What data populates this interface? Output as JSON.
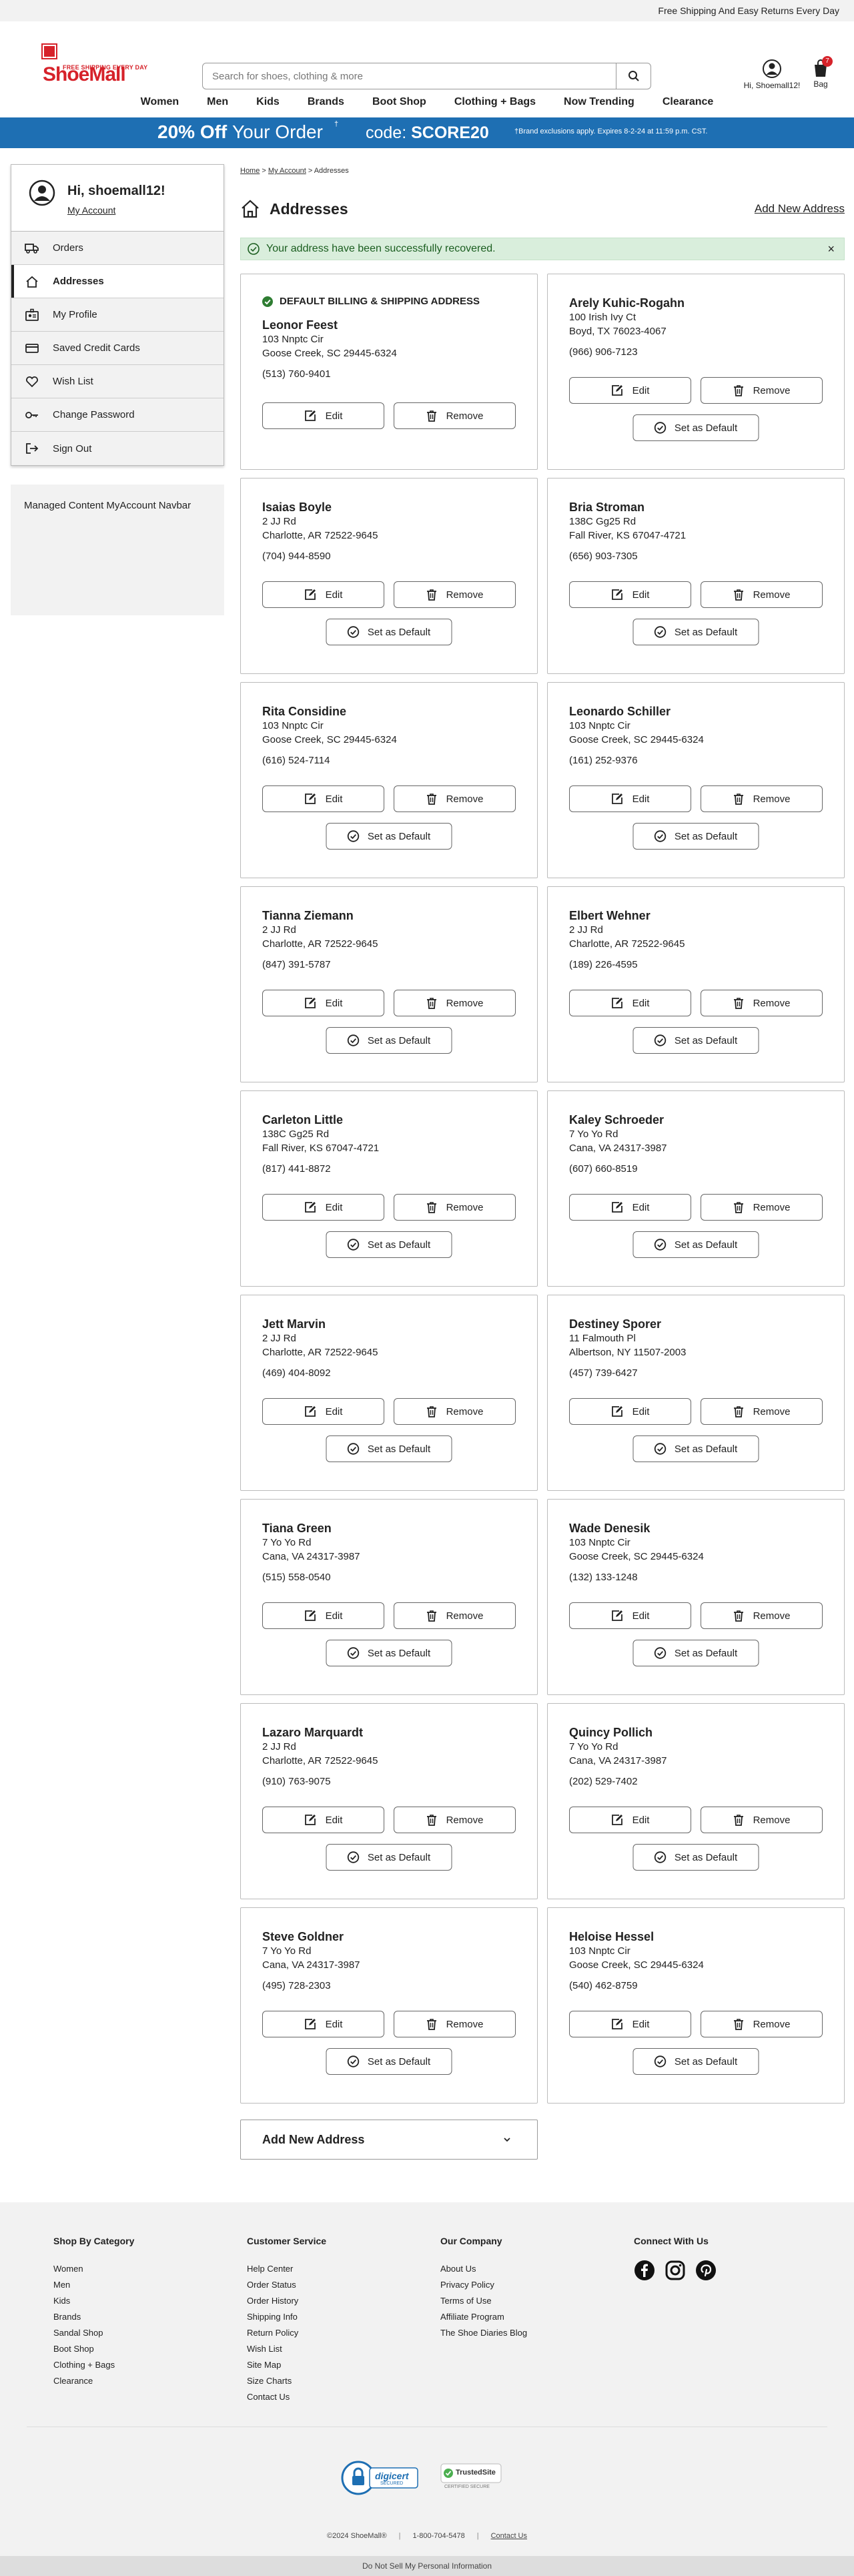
{
  "topbar": {
    "text": "Free Shipping And Easy Returns Every Day"
  },
  "header": {
    "logo_text": "ShoeMall",
    "logo_tagline": "FREE SHIPPING EVERY DAY",
    "search_placeholder": "Search for shoes, clothing & more",
    "account_label": "Hi, Shoemall12!",
    "bag_label": "Bag",
    "bag_count": "7"
  },
  "nav": [
    "Women",
    "Men",
    "Kids",
    "Brands",
    "Boot Shop",
    "Clothing + Bags",
    "Now Trending",
    "Clearance"
  ],
  "promo": {
    "amount": "20% Off",
    "rest": "Your Order",
    "sup": "†",
    "code_label": "code:",
    "code": "SCORE20",
    "fine": "†Brand exclusions apply. Expires 8-2-24 at 11:59 p.m. CST."
  },
  "sidebar": {
    "greeting": "Hi, shoemall12!",
    "account_link": "My Account",
    "items": [
      {
        "label": "Orders",
        "icon": "truck-icon"
      },
      {
        "label": "Addresses",
        "icon": "home-icon"
      },
      {
        "label": "My Profile",
        "icon": "profile-icon"
      },
      {
        "label": "Saved Credit Cards",
        "icon": "credit-card-icon"
      },
      {
        "label": "Wish List",
        "icon": "heart-icon"
      },
      {
        "label": "Change Password",
        "icon": "key-icon"
      },
      {
        "label": "Sign Out",
        "icon": "sign-out-icon"
      }
    ],
    "managed": "Managed Content MyAccount Navbar"
  },
  "breadcrumb": {
    "home": "Home",
    "sep": ">",
    "account": "My Account",
    "current": "Addresses"
  },
  "page": {
    "title": "Addresses",
    "add_new": "Add New Address",
    "alert": "Your address have been successfully recovered.",
    "alert_close": "×",
    "default_heading": "DEFAULT BILLING & SHIPPING ADDRESS",
    "edit": "Edit",
    "remove": "Remove",
    "set_default": "Set as Default",
    "add_new_accordion": "Add New Address"
  },
  "addresses": [
    {
      "name": "Leonor Feest",
      "line1": "103 Nnptc Cir",
      "line2": "Goose Creek, SC 29445-6324",
      "phone": "(513) 760-9401",
      "default": true
    },
    {
      "name": "Arely Kuhic-Rogahn",
      "line1": "100 Irish Ivy Ct",
      "line2": "Boyd, TX 76023-4067",
      "phone": "(966) 906-7123",
      "default": false
    },
    {
      "name": "Isaias Boyle",
      "line1": "2 JJ Rd",
      "line2": "Charlotte, AR 72522-9645",
      "phone": "(704) 944-8590",
      "default": false
    },
    {
      "name": "Bria Stroman",
      "line1": "138C Gg25 Rd",
      "line2": "Fall River, KS 67047-4721",
      "phone": "(656) 903-7305",
      "default": false
    },
    {
      "name": "Rita Considine",
      "line1": "103 Nnptc Cir",
      "line2": "Goose Creek, SC 29445-6324",
      "phone": "(616) 524-7114",
      "default": false
    },
    {
      "name": "Leonardo Schiller",
      "line1": "103 Nnptc Cir",
      "line2": "Goose Creek, SC 29445-6324",
      "phone": "(161) 252-9376",
      "default": false
    },
    {
      "name": "Tianna Ziemann",
      "line1": "2 JJ Rd",
      "line2": "Charlotte, AR 72522-9645",
      "phone": "(847) 391-5787",
      "default": false
    },
    {
      "name": "Elbert Wehner",
      "line1": "2 JJ Rd",
      "line2": "Charlotte, AR 72522-9645",
      "phone": "(189) 226-4595",
      "default": false
    },
    {
      "name": "Carleton Little",
      "line1": "138C Gg25 Rd",
      "line2": "Fall River, KS 67047-4721",
      "phone": "(817) 441-8872",
      "default": false
    },
    {
      "name": "Kaley Schroeder",
      "line1": "7 Yo Yo Rd",
      "line2": "Cana, VA 24317-3987",
      "phone": "(607) 660-8519",
      "default": false
    },
    {
      "name": "Jett Marvin",
      "line1": "2 JJ Rd",
      "line2": "Charlotte, AR 72522-9645",
      "phone": "(469) 404-8092",
      "default": false
    },
    {
      "name": "Destiney Sporer",
      "line1": "11 Falmouth Pl",
      "line2": "Albertson, NY 11507-2003",
      "phone": "(457) 739-6427",
      "default": false
    },
    {
      "name": "Tiana Green",
      "line1": "7 Yo Yo Rd",
      "line2": "Cana, VA 24317-3987",
      "phone": "(515) 558-0540",
      "default": false
    },
    {
      "name": "Wade Denesik",
      "line1": "103 Nnptc Cir",
      "line2": "Goose Creek, SC 29445-6324",
      "phone": "(132) 133-1248",
      "default": false
    },
    {
      "name": "Lazaro Marquardt",
      "line1": "2 JJ Rd",
      "line2": "Charlotte, AR 72522-9645",
      "phone": "(910) 763-9075",
      "default": false
    },
    {
      "name": "Quincy Pollich",
      "line1": "7 Yo Yo Rd",
      "line2": "Cana, VA 24317-3987",
      "phone": "(202) 529-7402",
      "default": false
    },
    {
      "name": "Steve Goldner",
      "line1": "7 Yo Yo Rd",
      "line2": "Cana, VA 24317-3987",
      "phone": "(495) 728-2303",
      "default": false
    },
    {
      "name": "Heloise Hessel",
      "line1": "103 Nnptc Cir",
      "line2": "Goose Creek, SC 29445-6324",
      "phone": "(540) 462-8759",
      "default": false
    }
  ],
  "footer": {
    "columns": [
      {
        "heading": "Shop By Category",
        "links": [
          "Women",
          "Men",
          "Kids",
          "Brands",
          "Sandal Shop",
          "Boot Shop",
          "Clothing + Bags",
          "Clearance"
        ]
      },
      {
        "heading": "Customer Service",
        "links": [
          "Help Center",
          "Order Status",
          "Order History",
          "Shipping Info",
          "Return Policy",
          "Wish List",
          "Site Map",
          "Size Charts",
          "Contact Us"
        ]
      },
      {
        "heading": "Our Company",
        "links": [
          "About Us",
          "Privacy Policy",
          "Terms of Use",
          "Affiliate Program",
          "The Shoe Diaries Blog"
        ]
      },
      {
        "heading": "Connect With Us",
        "links": []
      }
    ],
    "social": [
      "facebook-icon",
      "instagram-icon",
      "pinterest-icon"
    ],
    "digicert": "digicert",
    "digicert_sub": "SECURED",
    "trusted": "TrustedSite",
    "trusted_sub": "CERTIFIED SECURE",
    "copyright": "©2024 ShoeMall®",
    "phone": "1-800-704-5478",
    "contact": "Contact Us",
    "do_not_sell": "Do Not Sell My Personal Information"
  },
  "colors": {
    "brand_red": "#d6222a",
    "promo_blue": "#1e6fb3",
    "alert_green_bg": "#d9eedc"
  }
}
